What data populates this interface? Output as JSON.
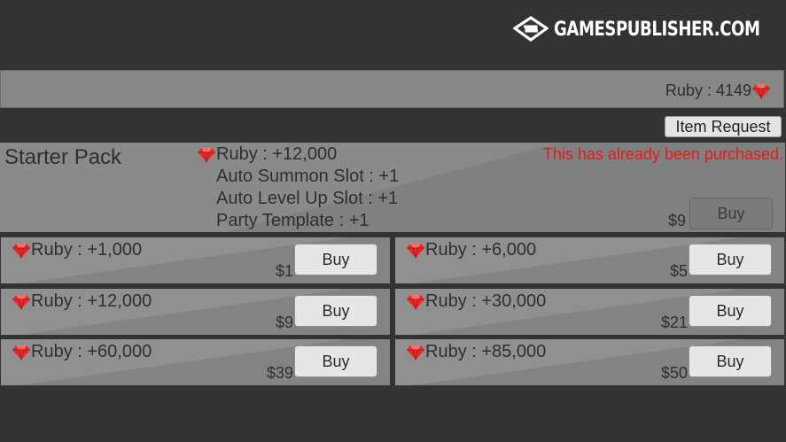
{
  "brand": {
    "logo_text": "GAMESPUBLISHER.COM",
    "logo_icon": "gamespublisher-logo-icon"
  },
  "header": {
    "ruby_balance": "Ruby : 4149",
    "ruby_icon": "ruby-gem-icon"
  },
  "toolbar": {
    "item_request_label": "Item Request"
  },
  "starter_pack": {
    "title": "Starter Pack",
    "lines": [
      "Ruby : +12,000",
      "Auto Summon Slot : +1",
      "Auto Level Up Slot : +1",
      "Party Template : +1"
    ],
    "status": "This has already been purchased.",
    "price": "$9",
    "buy_label": "Buy",
    "buy_enabled": false
  },
  "packs": [
    {
      "label": "Ruby : +1,000",
      "price": "$1",
      "buy_label": "Buy"
    },
    {
      "label": "Ruby : +6,000",
      "price": "$5",
      "buy_label": "Buy"
    },
    {
      "label": "Ruby : +12,000",
      "price": "$9",
      "buy_label": "Buy"
    },
    {
      "label": "Ruby : +30,000",
      "price": "$21",
      "buy_label": "Buy"
    },
    {
      "label": "Ruby : +60,000",
      "price": "$39",
      "buy_label": "Buy"
    },
    {
      "label": "Ruby : +85,000",
      "price": "$50",
      "buy_label": "Buy"
    }
  ],
  "colors": {
    "background": "#333333",
    "panel": "#8a8a8a",
    "ruby": "#e52a2a",
    "status_text": "#e11b1b"
  }
}
